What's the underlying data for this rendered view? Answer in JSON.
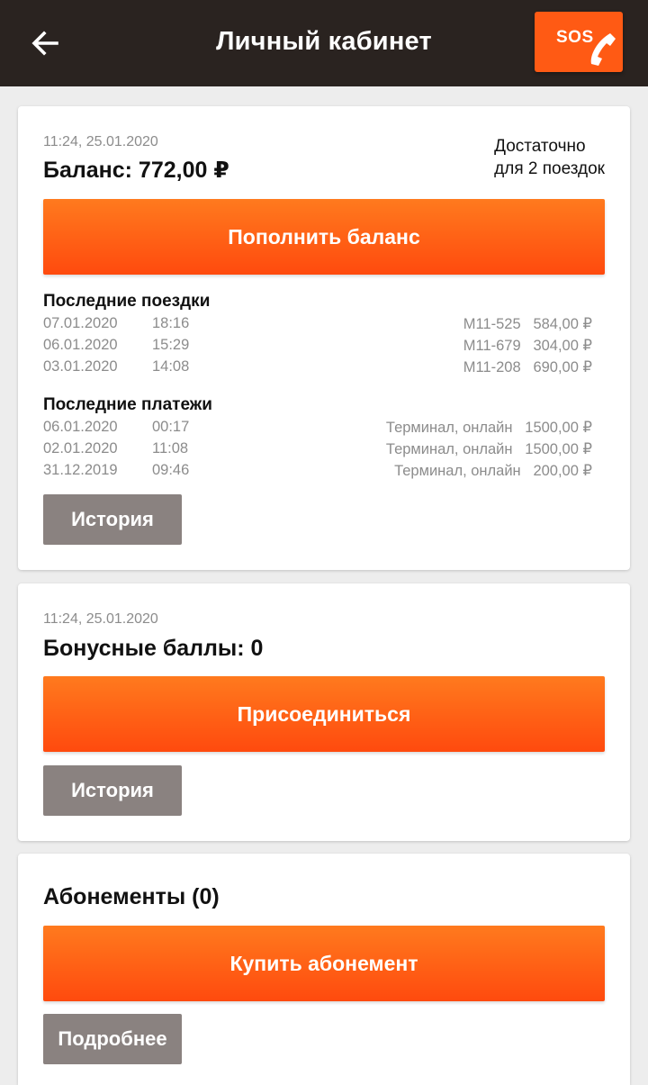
{
  "header": {
    "title": "Личный кабинет",
    "sos_label": "SOS",
    "bg_color": "#2a2320",
    "accent_color": "#ff5a14"
  },
  "balance_card": {
    "timestamp": "11:24, 25.01.2020",
    "balance": "Баланс: 772,00 ₽",
    "enough_line1": "Достаточно",
    "enough_line2": "для 2 поездок",
    "topup_label": "Пополнить баланс",
    "trips_title": "Последние поездки",
    "trips": [
      {
        "date": "07.01.2020",
        "time": "18:16",
        "route": "М11-525",
        "amount": "584,00 ₽"
      },
      {
        "date": "06.01.2020",
        "time": "15:29",
        "route": "М11-679",
        "amount": "304,00 ₽"
      },
      {
        "date": "03.01.2020",
        "time": "14:08",
        "route": "М11-208",
        "amount": "690,00 ₽"
      }
    ],
    "payments_title": "Последние платежи",
    "payments": [
      {
        "date": "06.01.2020",
        "time": "00:17",
        "method": "Терминал, онлайн",
        "amount": "1500,00 ₽"
      },
      {
        "date": "02.01.2020",
        "time": "11:08",
        "method": "Терминал, онлайн",
        "amount": "1500,00 ₽"
      },
      {
        "date": "31.12.2019",
        "time": "09:46",
        "method": "Терминал, онлайн",
        "amount": "200,00 ₽"
      }
    ],
    "history_label": "История"
  },
  "bonus_card": {
    "timestamp": "11:24, 25.01.2020",
    "title": "Бонусные баллы: 0",
    "join_label": "Присоединиться",
    "history_label": "История"
  },
  "subscriptions_card": {
    "title": "Абонементы (0)",
    "buy_label": "Купить абонемент",
    "details_label": "Подробнее"
  },
  "icons": {
    "back": "arrow-left-icon",
    "sos_phone": "phone-icon"
  }
}
